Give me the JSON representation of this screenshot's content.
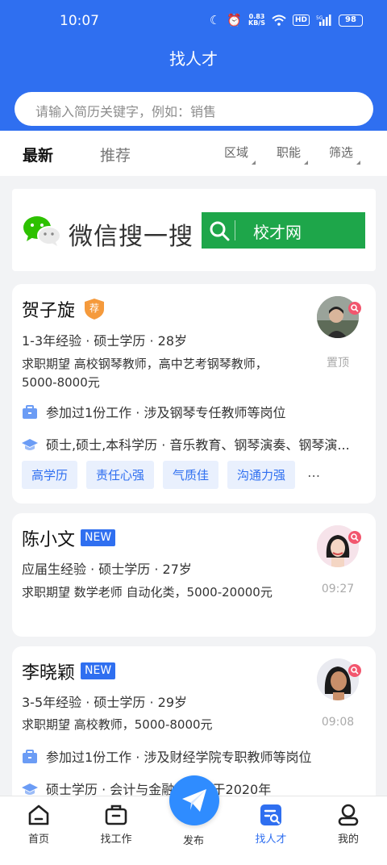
{
  "status_bar": {
    "time": "10:07",
    "speed_value": "0.83",
    "speed_unit": "KB/S",
    "hd": "HD",
    "network": "5G",
    "battery": "98"
  },
  "header": {
    "title": "找人才",
    "search_placeholder": "请输入简历关键字，例如：销售"
  },
  "filter_bar": {
    "tabs": [
      "最新",
      "推荐"
    ],
    "filters": [
      "区域",
      "职能",
      "筛选"
    ]
  },
  "banner": {
    "text": "微信搜一搜",
    "button_label": "校才网"
  },
  "candidates": [
    {
      "name": "贺子旋",
      "badge": "荐",
      "meta": "1-3年经验 · 硕士学历 · 28岁",
      "expectation": "求职期望 高校钢琴教师，高中艺考钢琴教师，5000-8000元",
      "experience": "参加过1份工作 · 涉及钢琴专任教师等岗位",
      "education": "硕士,硕士,本科学历 · 音乐教育、钢琴演奏、钢琴演...",
      "tags": [
        "高学历",
        "责任心强",
        "气质佳",
        "沟通力强"
      ],
      "tags_more": "…",
      "side_note": "置顶"
    },
    {
      "name": "陈小文",
      "badge": "NEW",
      "meta": "应届生经验 · 硕士学历 · 27岁",
      "expectation": "求职期望 数学老师 自动化类，5000-20000元",
      "side_note": "09:27"
    },
    {
      "name": "李晓颖",
      "badge": "NEW",
      "meta": "3-5年经验 · 硕士学历 · 29岁",
      "expectation": "求职期望 高校教师，5000-8000元",
      "experience": "参加过1份工作 · 涉及财经学院专职教师等岗位",
      "education": "硕士学历 · 会计与金融 · 毕业于2020年",
      "side_note": "09:08"
    }
  ],
  "bottom_nav": {
    "items": [
      "首页",
      "找工作",
      "发布",
      "找人才",
      "我的"
    ],
    "active": "找人才"
  },
  "colors": {
    "primary": "#2f6ff0",
    "wechat_green": "#1ea64a",
    "badge_orange": "#f59a3c"
  },
  "icons": [
    "moon-icon",
    "alarm-icon",
    "wifi-icon",
    "signal-icon",
    "battery-icon",
    "wechat-icon",
    "search-icon",
    "briefcase-icon",
    "graduation-cap-icon",
    "pin-icon",
    "home-icon",
    "job-icon",
    "paper-plane-icon",
    "talent-search-icon",
    "profile-icon"
  ]
}
